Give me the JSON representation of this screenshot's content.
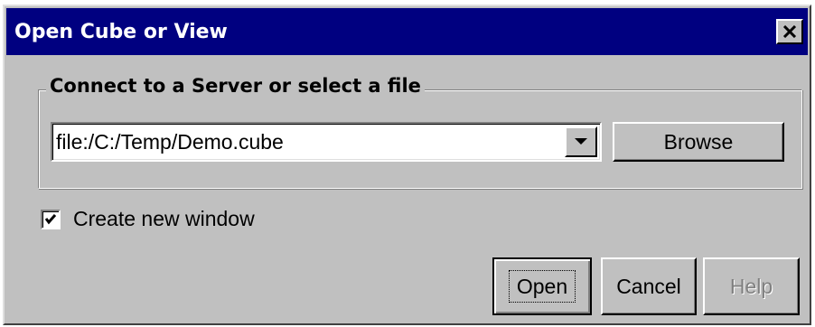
{
  "dialog": {
    "title": "Open Cube or View",
    "close_icon": "close-icon"
  },
  "connect_group": {
    "legend": "Connect to a Server or select a file",
    "location": {
      "value": "file:/C:/Temp/Demo.cube",
      "dropdown_icon": "chevron-down-icon"
    },
    "browse_label": "Browse"
  },
  "options": {
    "create_new_window": {
      "label": "Create new window",
      "checked": true
    }
  },
  "buttons": {
    "open_label": "Open",
    "cancel_label": "Cancel",
    "help_label": "Help",
    "help_enabled": false
  },
  "colors": {
    "titlebar": "#000080",
    "face": "#c0c0c0",
    "disabled_text": "#808080"
  }
}
